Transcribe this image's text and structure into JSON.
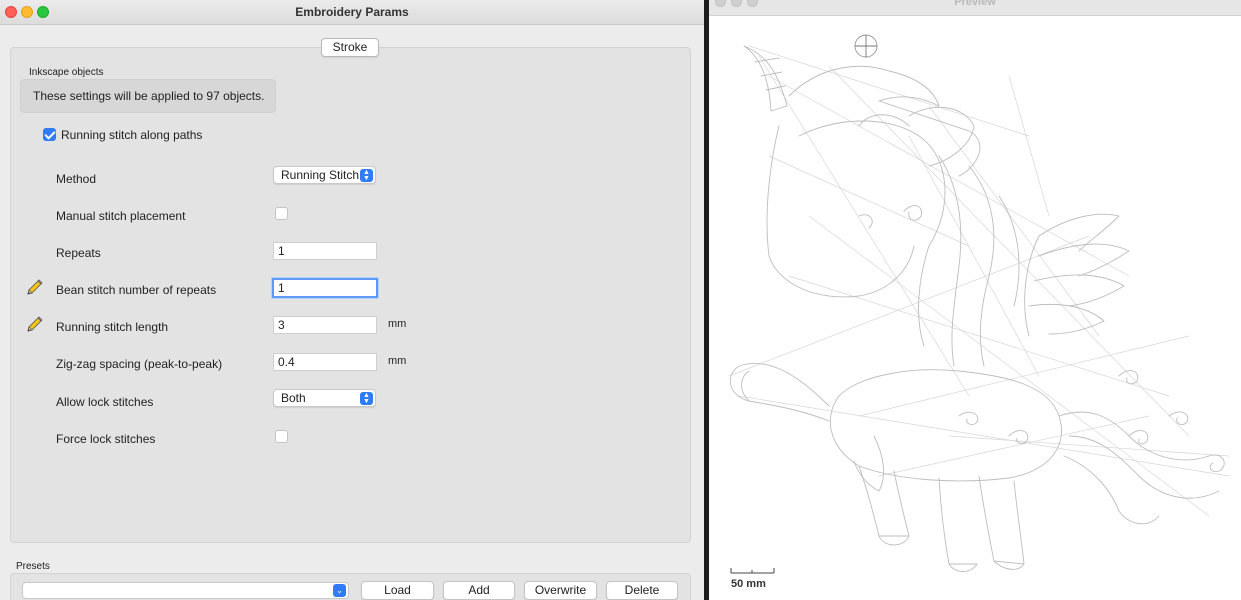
{
  "window": {
    "title": "Embroidery Params"
  },
  "tab": {
    "label": "Stroke"
  },
  "objects_group": {
    "label": "Inkscape objects",
    "message": "These settings will be applied to 97 objects."
  },
  "running_stitch": {
    "label": "Running stitch along paths",
    "checked": true
  },
  "params": {
    "method": {
      "label": "Method",
      "value": "Running Stitch"
    },
    "manual": {
      "label": "Manual stitch placement",
      "checked": false
    },
    "repeats": {
      "label": "Repeats",
      "value": "1"
    },
    "bean": {
      "label": "Bean stitch number of repeats",
      "value": "1"
    },
    "stitch_length": {
      "label": "Running stitch length",
      "value": "3",
      "unit": "mm"
    },
    "zigzag": {
      "label": "Zig-zag spacing (peak-to-peak)",
      "value": "0.4",
      "unit": "mm"
    },
    "allow_lock": {
      "label": "Allow lock stitches",
      "value": "Both"
    },
    "force_lock": {
      "label": "Force lock stitches",
      "checked": false
    }
  },
  "presets": {
    "label": "Presets",
    "selected": "",
    "load_label": "Load",
    "add_label": "Add",
    "overwrite_label": "Overwrite",
    "delete_label": "Delete"
  },
  "preview": {
    "title": "Preview",
    "scale_label": "50 mm"
  },
  "icons": {
    "pencil": "pencil-icon",
    "select_arrows": "up-down-chevron-icon",
    "checkmark": "checkmark-icon"
  },
  "colors": {
    "accent": "#2f7cf6",
    "panel": "#e3e3e3",
    "window": "#ececec"
  }
}
